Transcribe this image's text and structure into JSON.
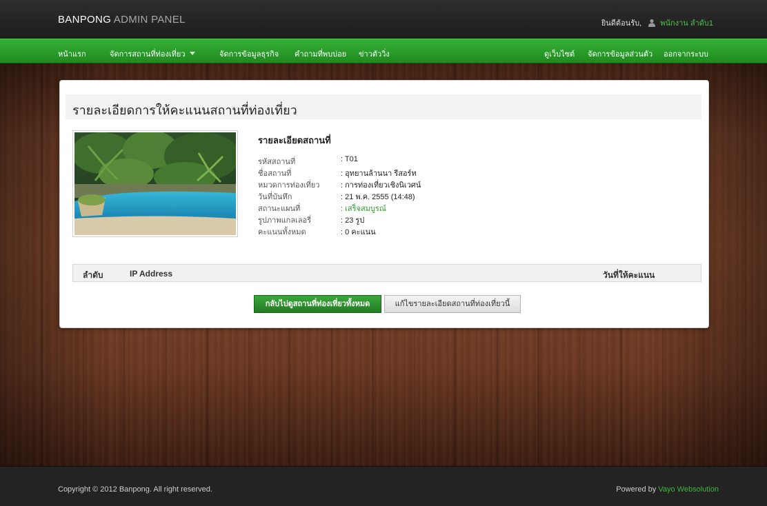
{
  "header": {
    "brand_main": "BANPONG",
    "brand_sub": "ADMIN PANEL",
    "welcome": "ยินดีต้อนรับ,",
    "user_name": "พนักงาน ลำดับ1"
  },
  "nav": {
    "left": [
      "หน้าแรก",
      "จัดการสถานที่ท่องเที่ยว",
      "จัดการข้อมูลธุรกิจ",
      "คำถามที่พบบ่อย",
      "ข่าวตัววิ่ง"
    ],
    "right": [
      "ดูเว็บไซต์",
      "จัดการข้อมูลส่วนตัว",
      "ออกจากระบบ"
    ]
  },
  "page": {
    "title": "รายละเอียดการให้คะแนนสถานที่ท่องเที่ยว",
    "detail_heading": "รายละเอียดสถานที่",
    "details": [
      {
        "label": "รหัสสถานที่",
        "value": ": T01"
      },
      {
        "label": "ชื่อสถานที่",
        "value": ": อุทยานล้านนา รีสอร์ท"
      },
      {
        "label": "หมวดการท่องเที่ยว",
        "value": ": การท่องเที่ยวเชิงนิเวศน์"
      },
      {
        "label": "วันที่บันทึก",
        "value": ": 21 พ.ค. 2555 (14:48)"
      },
      {
        "label": "สถานะแผนที่",
        "value": ": เสร็จสมบูรณ์"
      },
      {
        "label": "รูปภาพแกลเลอรี่",
        "value": ": 23 รูป"
      },
      {
        "label": "คะแนนทั้งหมด",
        "value": ": 0 คะแนน"
      }
    ],
    "table_headers": {
      "order": "ลำดับ",
      "ip": "IP Address",
      "date": "วันที่ให้คะแนน"
    },
    "buttons": {
      "back": "กลับไปดูสถานที่ท่องเที่ยวทั้งหมด",
      "edit": "แก้ไขรายละเอียดสถานที่ท่องเที่ยวนี้"
    }
  },
  "footer": {
    "copyright": "Copyright © 2012 Banpong. All right reserved.",
    "powered_by": "Powered by",
    "powered_name": "Vayo Websolution"
  },
  "colors": {
    "accent_green": "#2e9e2e",
    "topbar": "#1f1f1f",
    "footer": "#232323"
  }
}
